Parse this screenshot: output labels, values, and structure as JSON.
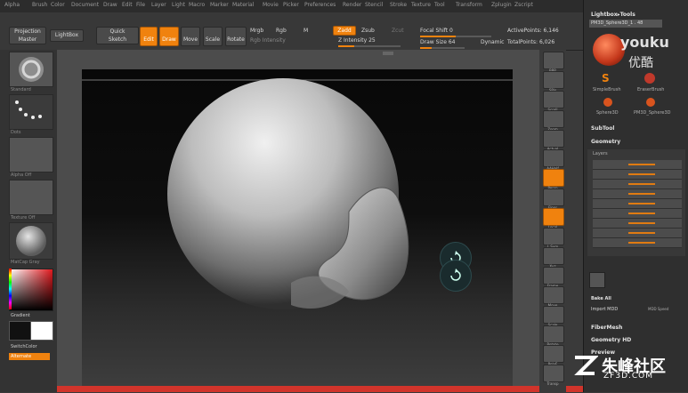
{
  "menu": {
    "items": [
      "Alpha",
      "Brush",
      "Color",
      "Document",
      "Draw",
      "Edit",
      "File",
      "Layer",
      "Light",
      "Macro",
      "Marker",
      "Material",
      "Movie",
      "Picker",
      "Preferences",
      "Render",
      "Stencil",
      "Stroke",
      "Texture",
      "Tool",
      "Transform",
      "Zplugin",
      "Zscript"
    ]
  },
  "toolbar": {
    "projection_master": "Projection\nMaster",
    "lightbox": "LightBox",
    "quick_sketch": "Quick\nSketch",
    "edit": "Edit",
    "draw": "Draw",
    "move": "Move",
    "scale": "Scale",
    "rotate": "Rotate",
    "mrgb": "Mrgb",
    "rgb": "Rgb",
    "m": "M",
    "zadd": "Zadd",
    "zsub": "Zsub",
    "zcut": "Zcut",
    "rgb_intensity": "Rgb Intensity",
    "z_intensity_label": "Z Intensity",
    "z_intensity_value": 25,
    "focal_shift_label": "Focal Shift",
    "focal_shift_value": 0,
    "draw_size_label": "Draw Size",
    "draw_size_value": 64,
    "dynamic": "Dynamic",
    "active_points_label": "ActivePoints:",
    "active_points_value": "6,146",
    "total_points_label": "TotalPoints:",
    "total_points_value": "6,026"
  },
  "left_shelf": {
    "thumbs": [
      "Standard",
      "Dots",
      "Alpha Off",
      "Texture Off",
      "MatCap Gray"
    ],
    "gradient": "Gradient",
    "switch_color": "SwitchColor",
    "alternate": "Alternate"
  },
  "right_shelf": {
    "buttons": [
      "BPR",
      "SPix",
      "Scroll",
      "Zoom",
      "Actual",
      "AAHalf",
      "Persp",
      "Floor",
      "Local",
      "L.Sym",
      "Xyz",
      "Frame",
      "Move",
      "Scale",
      "Rotate",
      "PolyF",
      "Transp"
    ]
  },
  "tray": {
    "lightbox_tools": "Lightbox▸Tools",
    "tool_name": "PM3D_Sphere3D_1 . 48",
    "tool_items": [
      "SimpleBrush",
      "EraserBrush",
      "Sphere3D",
      "PM3D_Sphere3D"
    ],
    "subtool": "SubTool",
    "geometry": "Geometry",
    "layers": "Layers",
    "bake_all": "Bake All",
    "import_mdd": "Import MDD",
    "mdd_speed": "MDD Speed",
    "fibermesh": "FiberMesh",
    "geometry_hd": "Geometry HD",
    "preview": "Preview"
  },
  "watermarks": {
    "youku": "youku",
    "youku_cn": "优酷",
    "site_cn": "朱峰社区",
    "site_url": "ZF3D.COM"
  },
  "colors": {
    "accent": "#f0820e",
    "background": "#3a3a3a",
    "canvas": "#0a0a0a"
  }
}
